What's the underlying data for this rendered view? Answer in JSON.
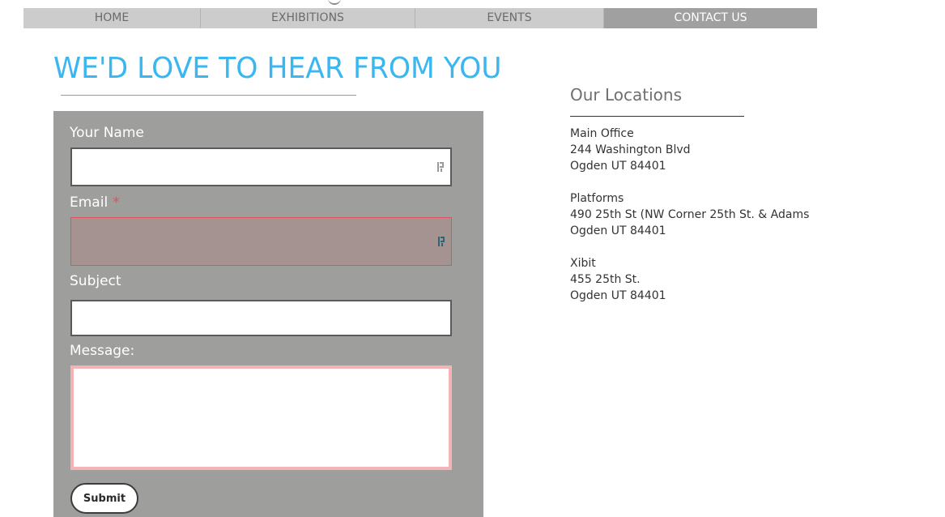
{
  "nav": {
    "items": [
      {
        "label": "HOME"
      },
      {
        "label": "EXHIBITIONS"
      },
      {
        "label": "EVENTS"
      },
      {
        "label": "CONTACT US"
      }
    ],
    "active": "CONTACT US"
  },
  "heading": "WE'D LOVE TO HEAR FROM YOU",
  "form": {
    "name_label": "Your Name",
    "name_value": "",
    "email_label": "Email",
    "email_required_mark": "*",
    "email_value": "",
    "subject_label": "Subject",
    "subject_value": "",
    "message_label": "Message:",
    "message_value": "",
    "submit_label": "Submit"
  },
  "locations": {
    "title": "Our Locations",
    "list": [
      {
        "name": "Main Office",
        "street": "244 Washington Blvd",
        "city": "Ogden UT 84401"
      },
      {
        "name": "Platforms",
        "street": "490 25th St (NW Corner 25th St. & Adams",
        "city": "Ogden UT 84401"
      },
      {
        "name": "Xibit",
        "street": "455 25th St.",
        "city": "Ogden UT 84401"
      }
    ]
  },
  "colors": {
    "accent": "#3ab6f0",
    "nav_bg": "#cccccc",
    "nav_active_bg": "#a0a0a0",
    "form_bg": "#9e9e9d",
    "error": "#e0525b",
    "message_border": "#f5b3b5"
  },
  "icons": {
    "password_manager": "password-manager-icon"
  }
}
